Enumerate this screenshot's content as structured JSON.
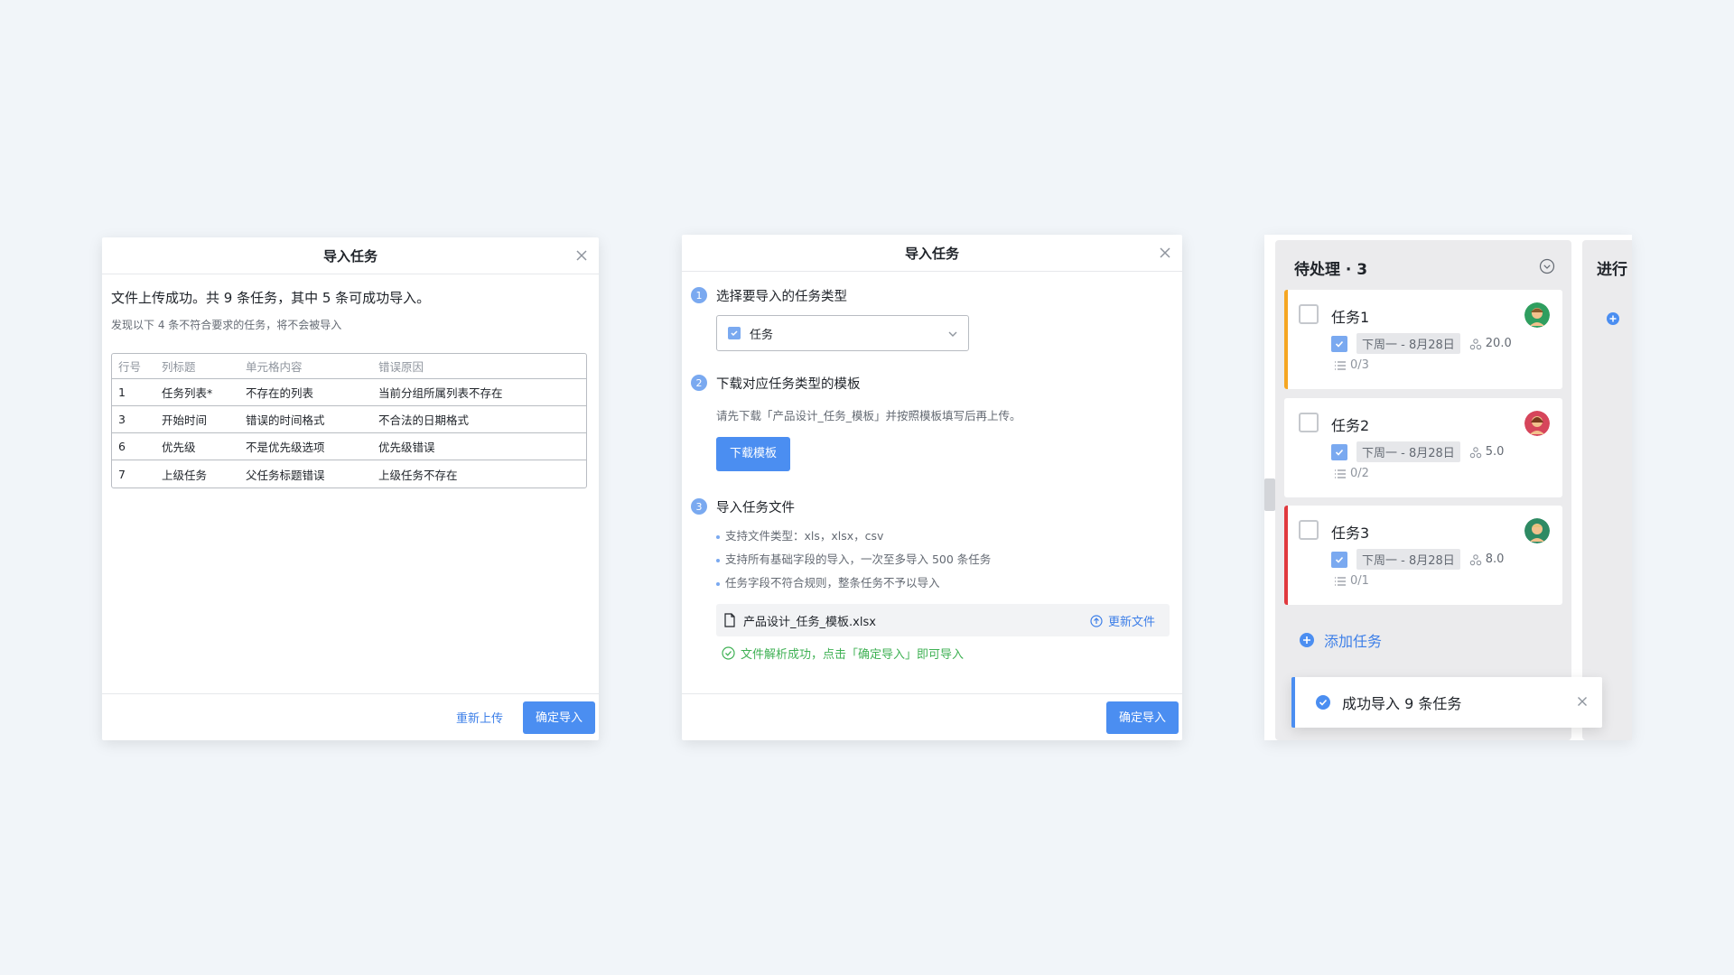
{
  "colors": {
    "background": "#f1f5f9",
    "primary": "#4b8ef1",
    "link": "#3d7fe8",
    "success": "#3fb154",
    "accent_orange": "#f5a623",
    "accent_red": "#e0393e"
  },
  "dialog1": {
    "title": "导入任务",
    "summary": "文件上传成功。共 9 条任务，其中 5 条可成功导入。",
    "sub": "发现以下 4 条不符合要求的任务，将不会被导入",
    "table": {
      "headers": [
        "行号",
        "列标题",
        "单元格内容",
        "错误原因"
      ],
      "rows": [
        [
          "1",
          "任务列表*",
          "不存在的列表",
          "当前分组所属列表不存在"
        ],
        [
          "3",
          "开始时间",
          "错误的时间格式",
          "不合法的日期格式"
        ],
        [
          "6",
          "优先级",
          "不是优先级选项",
          "优先级错误"
        ],
        [
          "7",
          "上级任务",
          "父任务标题错误",
          "上级任务不存在"
        ]
      ]
    },
    "reupload_label": "重新上传",
    "confirm_label": "确定导入"
  },
  "dialog2": {
    "title": "导入任务",
    "step1": {
      "num": "1",
      "title": "选择要导入的任务类型",
      "select_value": "任务"
    },
    "step2": {
      "num": "2",
      "title": "下载对应任务类型的模板",
      "hint": "请先下载「产品设计_任务_模板」并按照模板填写后再上传。",
      "button": "下载模板"
    },
    "step3": {
      "num": "3",
      "title": "导入任务文件",
      "bullets": [
        "支持文件类型：xls，xlsx，csv",
        "支持所有基础字段的导入，一次至多导入 500 条任务",
        "任务字段不符合规则，整条任务不予以导入"
      ],
      "file_name": "产品设计_任务_模板.xlsx",
      "update_label": "更新文件",
      "success_text": "文件解析成功，点击「确定导入」即可导入"
    },
    "confirm_label": "确定导入"
  },
  "kanban": {
    "col1": {
      "title": "待处理 · 3",
      "cards": [
        {
          "title": "任务1",
          "date": "下周一 - 8月28日",
          "weight": "20.0",
          "subtasks": "0/3",
          "accent": "#f5a623",
          "avatar": "#2f9e5f"
        },
        {
          "title": "任务2",
          "date": "下周一 - 8月28日",
          "weight": "5.0",
          "subtasks": "0/2",
          "accent": "",
          "avatar": "#d6455b"
        },
        {
          "title": "任务3",
          "date": "下周一 - 8月28日",
          "weight": "8.0",
          "subtasks": "0/1",
          "accent": "#e0393e",
          "avatar": "#2e8a63"
        }
      ],
      "add_label": "添加任务"
    },
    "col2": {
      "title": "进行"
    },
    "toast": "成功导入 9 条任务"
  }
}
